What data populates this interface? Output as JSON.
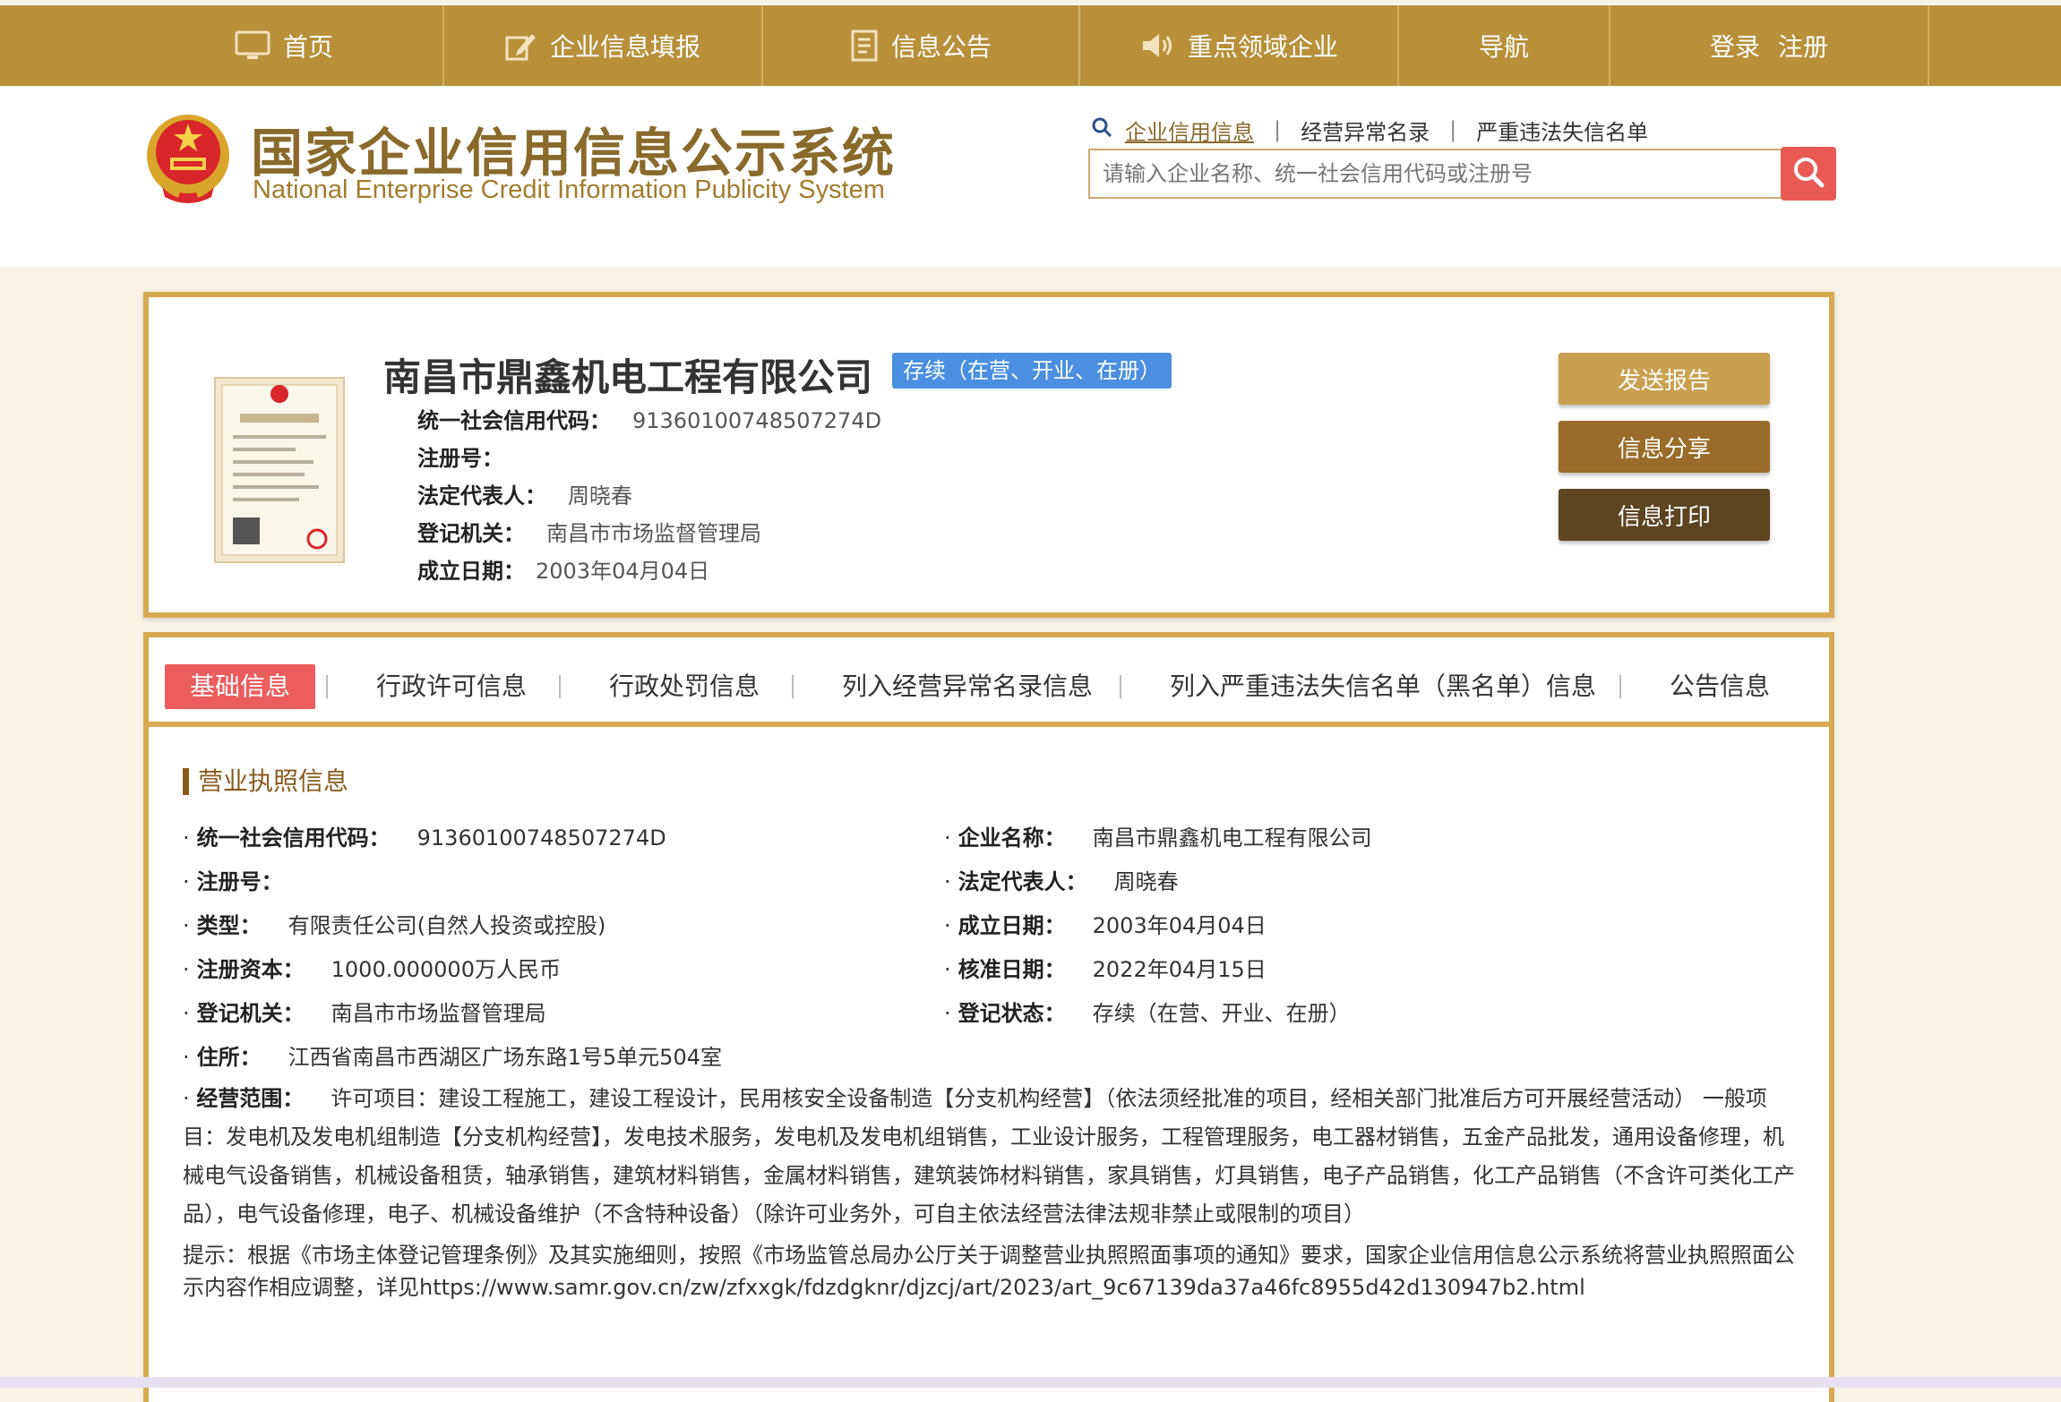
{
  "nav": {
    "home": "首页",
    "report": "企业信息填报",
    "notice": "信息公告",
    "key_industry": "重点领域企业",
    "guide": "导航",
    "login": "登录",
    "register": "注册"
  },
  "site": {
    "title": "国家企业信用信息公示系统",
    "subtitle": "National Enterprise Credit Information Publicity System"
  },
  "search": {
    "tabs": [
      "企业信用信息",
      "经营异常名录",
      "严重违法失信名单"
    ],
    "placeholder": "请输入企业名称、统一社会信用代码或注册号"
  },
  "company": {
    "name": "南昌市鼎鑫机电工程有限公司",
    "status": "存续（在营、开业、在册）",
    "credit_code_label": "统一社会信用代码：",
    "credit_code": "91360100748507274D",
    "reg_no_label": "注册号：",
    "reg_no": "",
    "legal_rep_label": "法定代表人：",
    "legal_rep": "周晓春",
    "authority_label": "登记机关：",
    "authority": "南昌市市场监督管理局",
    "established_label": "成立日期：",
    "established": "2003年04月04日"
  },
  "actions": {
    "send_report": "发送报告",
    "share": "信息分享",
    "print": "信息打印"
  },
  "tabs": [
    "基础信息",
    "行政许可信息",
    "行政处罚信息",
    "列入经营异常名录信息",
    "列入严重违法失信名单（黑名单）信息",
    "公告信息"
  ],
  "license": {
    "section_title": "营业执照信息",
    "credit_code_label": "统一社会信用代码：",
    "credit_code": "91360100748507274D",
    "name_label": "企业名称：",
    "name": "南昌市鼎鑫机电工程有限公司",
    "reg_no_label": "注册号：",
    "reg_no": "",
    "legal_rep_label": "法定代表人：",
    "legal_rep": "周晓春",
    "type_label": "类型：",
    "type": "有限责任公司(自然人投资或控股)",
    "established_label": "成立日期：",
    "established": "2003年04月04日",
    "capital_label": "注册资本：",
    "capital": "1000.000000万人民币",
    "approved_label": "核准日期：",
    "approved": "2022年04月15日",
    "authority_label": "登记机关：",
    "authority": "南昌市市场监督管理局",
    "reg_status_label": "登记状态：",
    "reg_status": "存续（在营、开业、在册）",
    "address_label": "住所：",
    "address": "江西省南昌市西湖区广场东路1号5单元504室",
    "scope_label": "经营范围：",
    "scope": "许可项目：建设工程施工，建设工程设计，民用核安全设备制造【分支机构经营】（依法须经批准的项目，经相关部门批准后方可开展经营活动） 一般项目：发电机及发电机组制造【分支机构经营】，发电技术服务，发电机及发电机组销售，工业设计服务，工程管理服务，电工器材销售，五金产品批发，通用设备修理，机械电气设备销售，机械设备租赁，轴承销售，建筑材料销售，金属材料销售，建筑装饰材料销售，家具销售，灯具销售，电子产品销售，化工产品销售（不含许可类化工产品），电气设备修理，电子、机械设备维护（不含特种设备）（除许可业务外，可自主依法经营法律法规非禁止或限制的项目）",
    "hint": "提示：根据《市场主体登记管理条例》及其实施细则，按照《市场监管总局办公厅关于调整营业执照照面事项的通知》要求，国家企业信用信息公示系统将营业执照照面公示内容作相应调整，详见https://www.samr.gov.cn/zw/zfxxgk/fdzdgknr/djzcj/art/2023/art_9c67139da37a46fc8955d42d130947b2.html"
  },
  "colors": {
    "nav_bg": "#b8903a",
    "brand": "#8a6a2c",
    "card_border": "#d7aa52",
    "badge": "#4a8fe0",
    "active_tab": "#ec5d5d",
    "search_btn": "#ea5a55",
    "btn_send": "#c9a050",
    "btn_share": "#9a6c2a",
    "btn_print": "#5e4520"
  },
  "icons": {
    "home": "monitor-icon",
    "report": "pen-icon",
    "notice": "document-icon",
    "key_industry": "speaker-icon",
    "search": "magnifier-icon"
  }
}
